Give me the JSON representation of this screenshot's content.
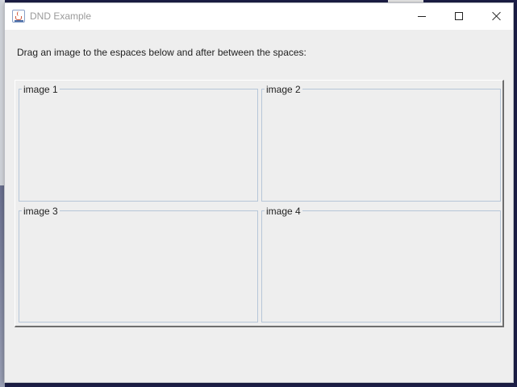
{
  "window": {
    "title": "DND Example",
    "icon": "java-cup-icon"
  },
  "controls": {
    "minimize": "minimize-icon",
    "maximize": "maximize-icon",
    "close": "close-icon"
  },
  "instruction": "Drag an image to the espaces below and after between the spaces:",
  "zones": [
    {
      "label": "image 1"
    },
    {
      "label": "image 2"
    },
    {
      "label": "image 3"
    },
    {
      "label": "image 4"
    }
  ],
  "colors": {
    "window_bg": "#eeeeee",
    "zone_border": "#b6c6d8",
    "desktop_bg": "#1d1f49"
  }
}
